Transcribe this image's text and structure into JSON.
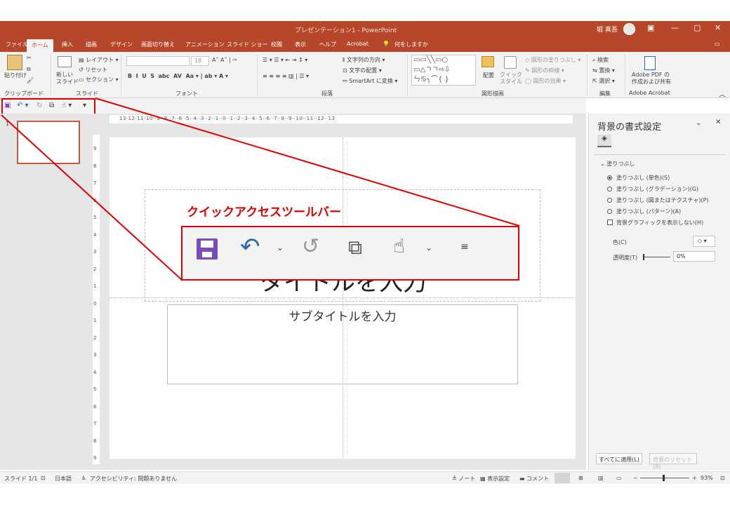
{
  "window": {
    "title": "プレゼンテーション1 - PowerPoint",
    "user": "堀 真吾",
    "minimize": "—",
    "restore": "▢",
    "close": "✕",
    "accent": "#b7472a"
  },
  "tabs": [
    {
      "label": "ファイル"
    },
    {
      "label": "ホーム"
    },
    {
      "label": "挿入"
    },
    {
      "label": "描画"
    },
    {
      "label": "デザイン"
    },
    {
      "label": "画面切り替え"
    },
    {
      "label": "アニメーション"
    },
    {
      "label": "スライド ショー"
    },
    {
      "label": "校閲"
    },
    {
      "label": "表示"
    },
    {
      "label": "ヘルプ"
    },
    {
      "label": "Acrobat"
    },
    {
      "label": "何をしますか"
    }
  ],
  "ribbon": {
    "paste": "貼り付け",
    "new_slide": "新しい\nスライド",
    "layout": "レイアウト",
    "reset": "リセット",
    "section": "セクション",
    "font_size": "18",
    "text_direction": "文字列の方向",
    "align_text": "文字の配置",
    "smartart": "SmartArt に変換",
    "arrange": "配置",
    "quick_style": "クイック\nスタイル",
    "shape_fill": "図形の塗りつぶし",
    "shape_outline": "図形の枠線",
    "shape_effects": "図形の効果",
    "find": "検索",
    "replace": "置換",
    "select": "選択",
    "adobe_pdf": "Adobe PDF の\n作成および共有",
    "groups": {
      "clipboard": "クリップボード",
      "slides": "スライド",
      "font": "フォント",
      "paragraph": "段落",
      "drawing": "図形描画",
      "editing": "編集",
      "acrobat": "Adobe Acrobat"
    }
  },
  "annotation": {
    "label": "クイックアクセスツールバー",
    "color": "#e00000"
  },
  "ruler": {
    "horizontal": [
      "13",
      "12",
      "11",
      "10",
      "9",
      "8",
      "7",
      "6",
      "5",
      "4",
      "3",
      "2",
      "1",
      "0",
      "1",
      "2",
      "3",
      "4",
      "5",
      "6",
      "7",
      "8",
      "9",
      "10",
      "11",
      "12",
      "13"
    ],
    "vertical": [
      "9",
      "8",
      "7",
      "6",
      "5",
      "4",
      "3",
      "2",
      "1",
      "0",
      "1",
      "2",
      "3",
      "4",
      "5",
      "6",
      "7",
      "8",
      "9"
    ]
  },
  "slide_panel": {
    "number": "1"
  },
  "slide": {
    "title_placeholder": "タイトルを入力",
    "subtitle_placeholder": "サブタイトルを入力"
  },
  "format_pane": {
    "title": "背景の書式設定",
    "section": "塗りつぶし",
    "options": [
      {
        "label": "塗りつぶし (単色)(S)",
        "selected": true
      },
      {
        "label": "塗りつぶし (グラデーション)(G)",
        "selected": false
      },
      {
        "label": "塗りつぶし (図またはテクスチャ)(P)",
        "selected": false
      },
      {
        "label": "塗りつぶし (パターン)(A)",
        "selected": false
      }
    ],
    "hide_bg": "背景グラフィックを表示しない(H)",
    "color_label": "色(C)",
    "transparency_label": "透明度(T)",
    "transparency_value": "0%",
    "apply_all": "すべてに適用(L)",
    "reset_bg": "背景のリセット(B)"
  },
  "status": {
    "slide": "スライド 1/1",
    "language": "日本語",
    "accessibility": "アクセシビリティ: 問題ありません",
    "notes": "ノート",
    "display": "表示設定",
    "comment": "コメント",
    "zoom": "93%"
  }
}
